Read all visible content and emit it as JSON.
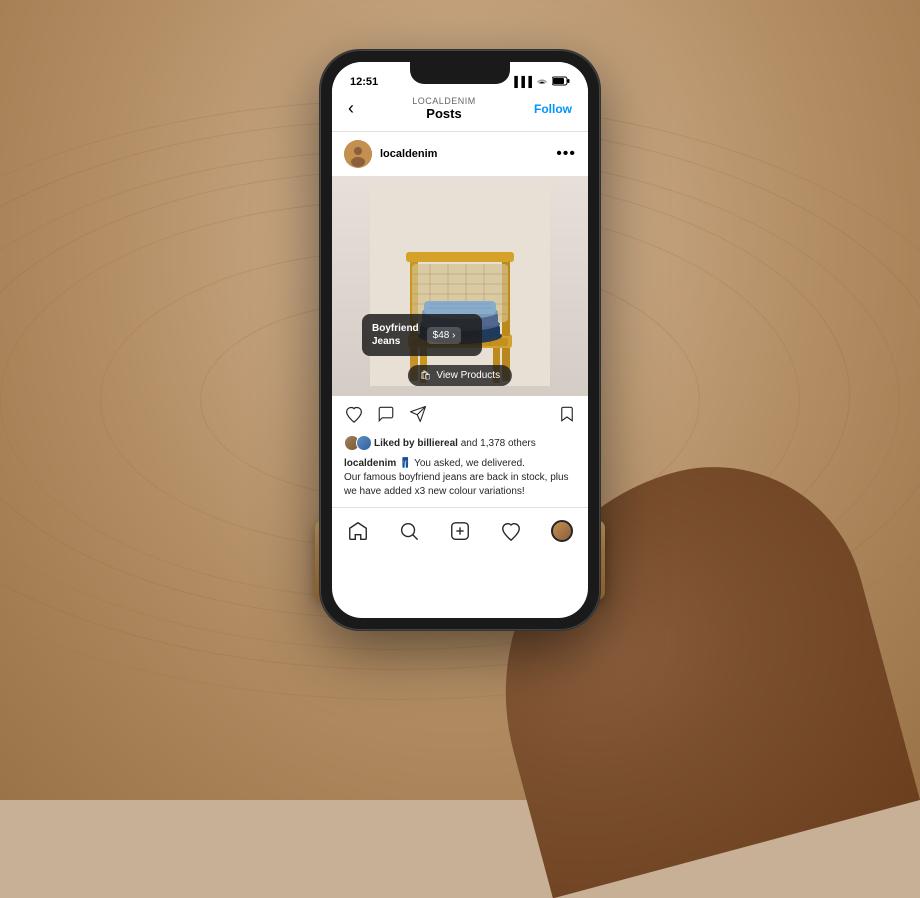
{
  "background": {
    "description": "Wooden table background with radial grain pattern"
  },
  "phone": {
    "status_bar": {
      "time": "12:51",
      "signal_icon": "▐▐▐",
      "wifi_icon": "WiFi",
      "battery_icon": "🔋"
    },
    "header": {
      "back_label": "‹",
      "account_label": "LOCALDENIM",
      "page_title": "Posts",
      "follow_label": "Follow"
    },
    "post_header": {
      "username": "localdenim",
      "more_icon": "•••"
    },
    "product_tag": {
      "product_name": "Boyfriend\nJeans",
      "price": "$48 ›"
    },
    "view_products_button": {
      "label": "View Products",
      "icon": "🛍"
    },
    "actions": {
      "like_icon": "♡",
      "comment_icon": "○",
      "share_icon": "▷",
      "bookmark_icon": "⊓"
    },
    "likes": {
      "users": "billiereal",
      "count": "1,378",
      "text": "Liked by billiereal and 1,378 others"
    },
    "caption": {
      "username": "localdenim",
      "hashtag": "👖",
      "text": " You asked, we delivered.\nOur famous boyfriend jeans are back in stock, plus\nwe have added x3 new colour variations!"
    },
    "bottom_nav": {
      "home_icon": "⌂",
      "search_icon": "○",
      "add_icon": "⊕",
      "heart_icon": "♡",
      "profile_icon": "profile"
    }
  }
}
